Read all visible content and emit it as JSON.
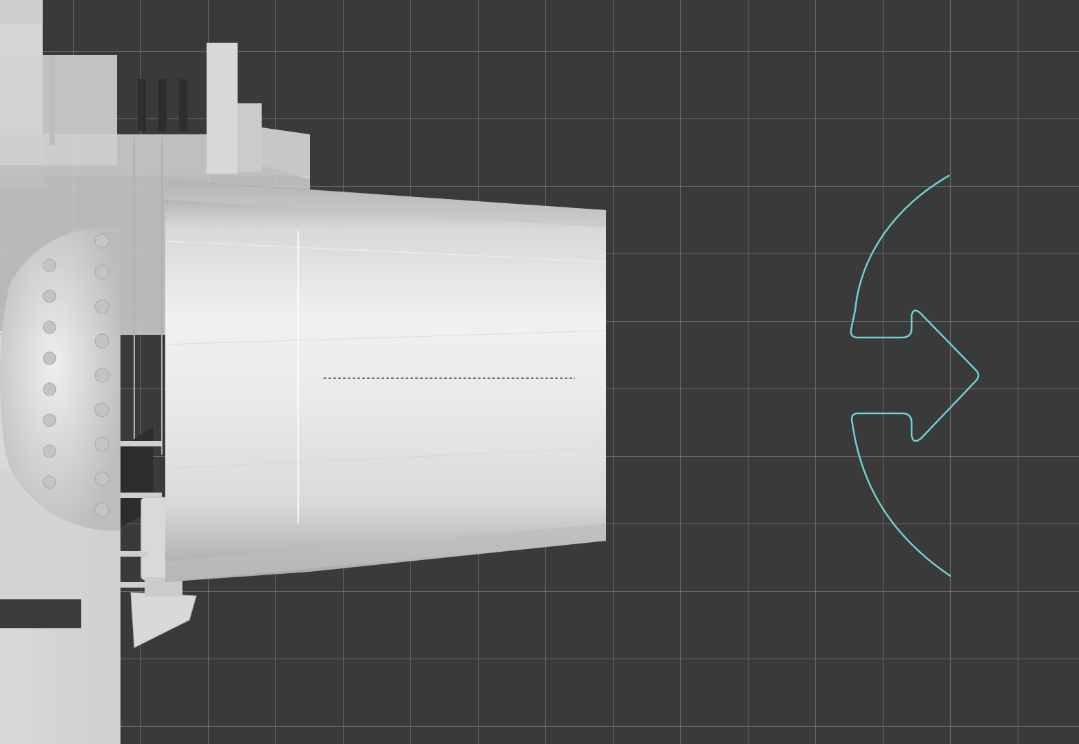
{
  "viewport": {
    "background_color": "#3a3a3a",
    "grid_color": "#969696"
  },
  "model": {
    "color": "#e2e2e2",
    "shade_color": "#bdbdbd"
  },
  "gizmo": {
    "type": "rotate-arrow",
    "color": "#6fd3d3"
  }
}
